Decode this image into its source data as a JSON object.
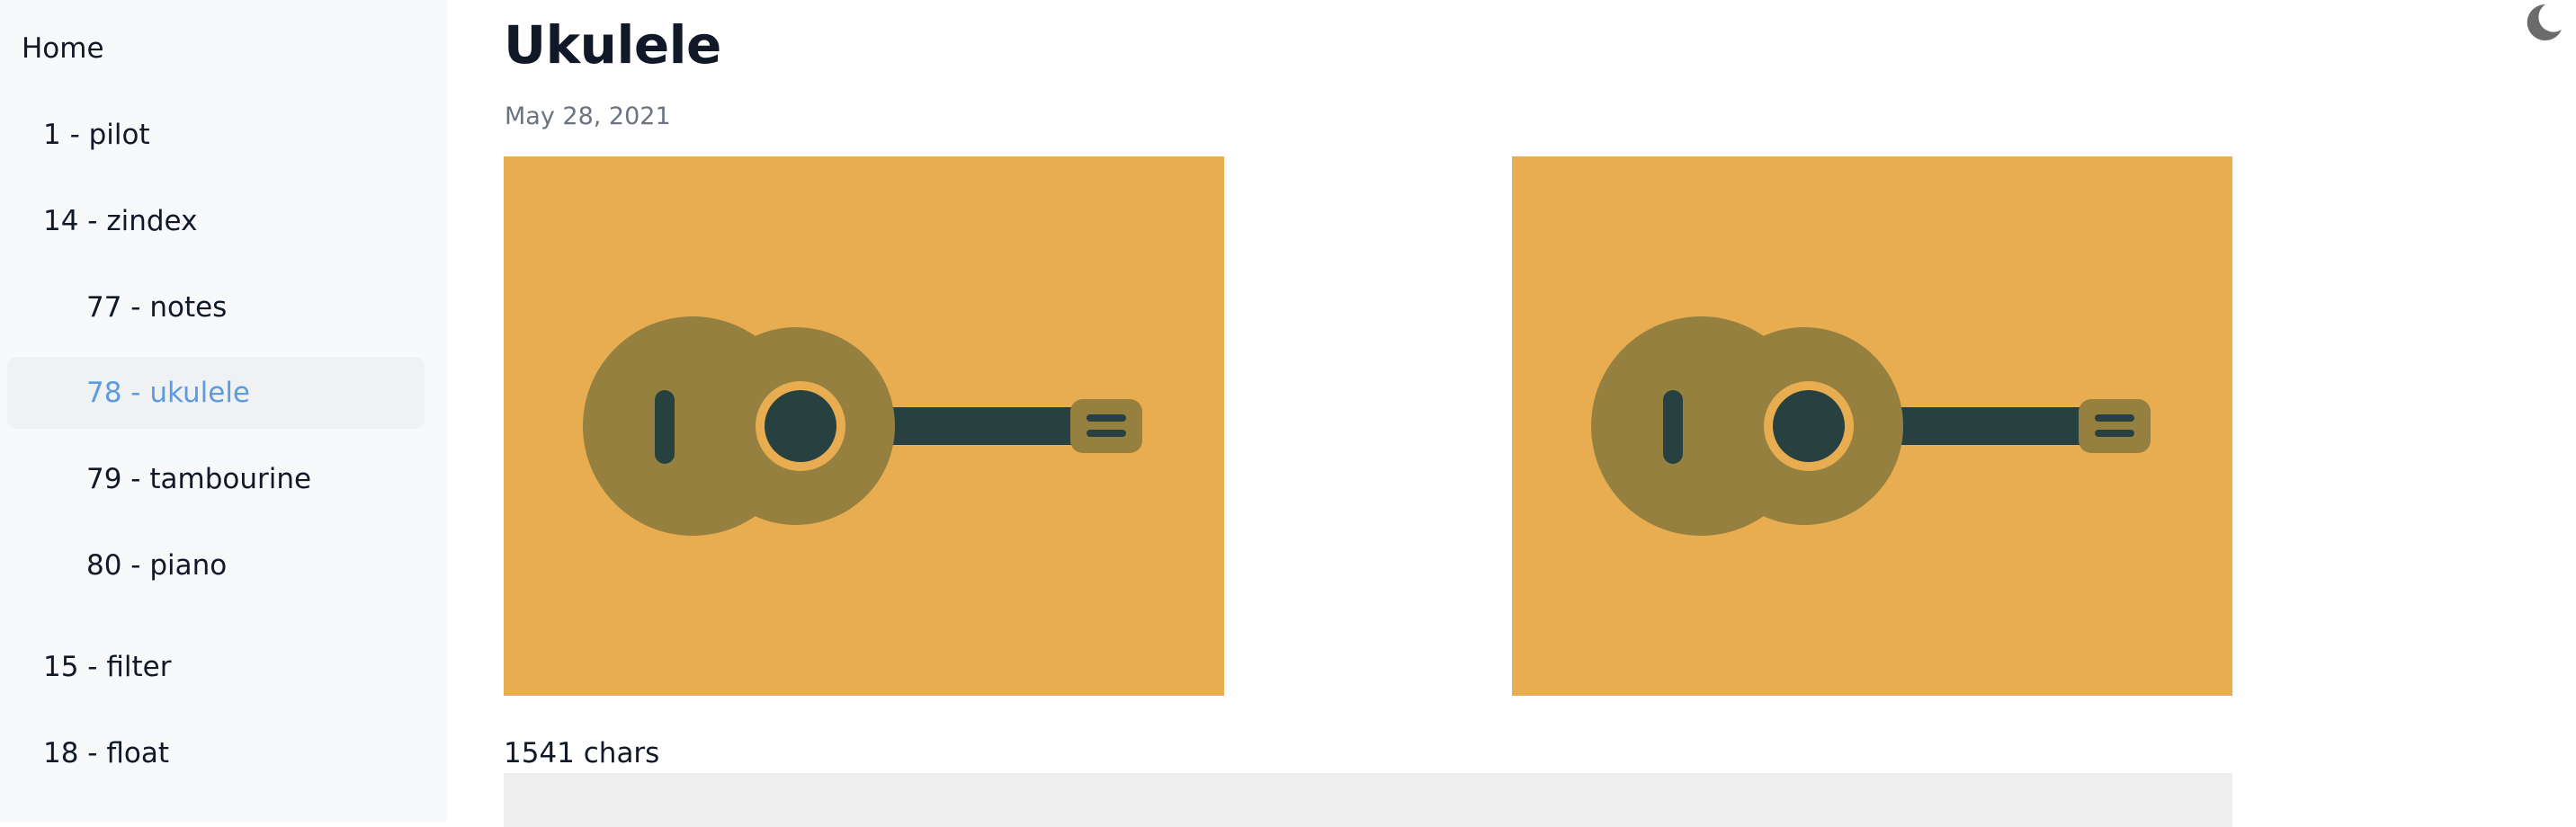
{
  "sidebar": {
    "home": "Home",
    "items": [
      {
        "label": "1 - pilot"
      },
      {
        "label": "14 - zindex"
      },
      {
        "label": "77 - notes"
      },
      {
        "label": "78 - ukulele",
        "active": true
      },
      {
        "label": "79 - tambourine"
      },
      {
        "label": "80 - piano"
      },
      {
        "label": "15 - filter"
      },
      {
        "label": "18 - float"
      }
    ]
  },
  "page": {
    "title": "Ukulele",
    "date": "May 28, 2021",
    "char_count": "1541 chars"
  },
  "images": [
    {
      "icon": "ukulele-illustration"
    },
    {
      "icon": "ukulele-illustration"
    }
  ],
  "header": {
    "theme_toggle_icon": "moon-icon"
  },
  "colors": {
    "sidebar_bg": "#f8f9fb",
    "active_link": "#5b9be0",
    "image_bg": "#e8ad50",
    "ukulele_body": "#958040",
    "ukulele_neck": "#26413f",
    "code_block_bg": "#eeeeee"
  }
}
